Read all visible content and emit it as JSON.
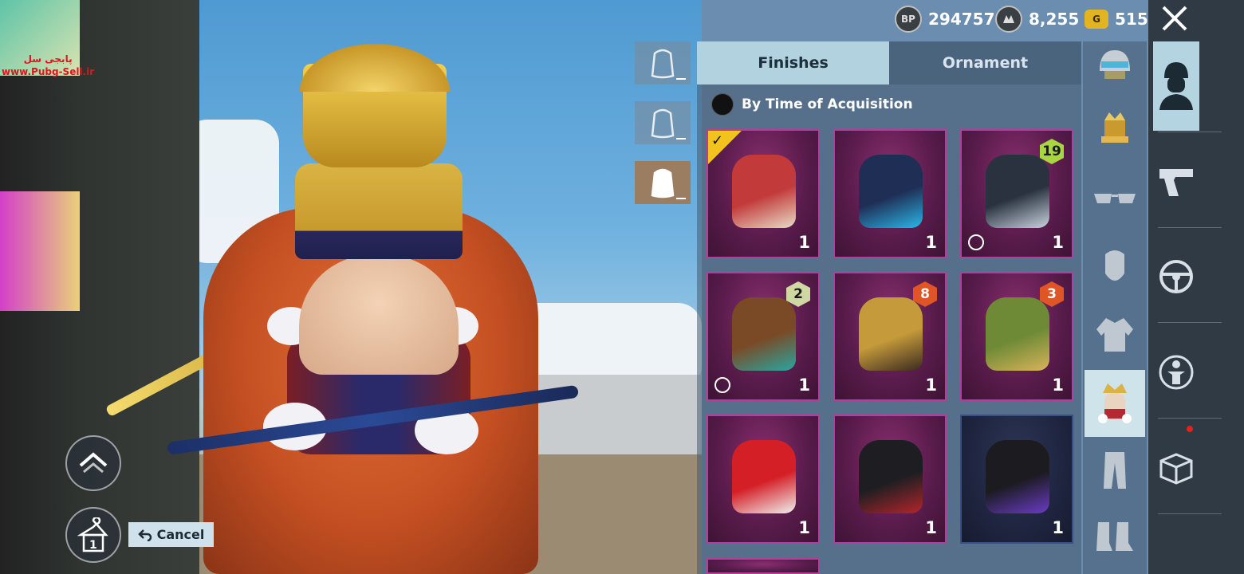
{
  "currency": {
    "bp": {
      "icon": "BP",
      "value": "294757"
    },
    "silver": {
      "icon": "silver-fragment-icon",
      "value": "8,255"
    },
    "uc": {
      "icon": "G",
      "value": "515"
    }
  },
  "watermark": {
    "line1": "پابجی سل",
    "line2": "www.Pubg-Sell.ir"
  },
  "tabs": {
    "finishes": "Finishes",
    "ornament": "Ornament"
  },
  "sort": {
    "label": "By Time of Acquisition"
  },
  "cancel": {
    "label": "Cancel"
  },
  "wardrobe_badge": "1",
  "items": [
    {
      "name": "nutcracker-backpack",
      "qty": "1",
      "equipped": true,
      "level": "",
      "cloud": false,
      "style": "purple",
      "colors": [
        "#c23a3a",
        "#e8dcc8"
      ]
    },
    {
      "name": "blue-tech-backpack",
      "qty": "1",
      "equipped": false,
      "level": "",
      "cloud": false,
      "style": "purple",
      "colors": [
        "#1f2e55",
        "#2bb7e8"
      ]
    },
    {
      "name": "dark-horned-backpack",
      "qty": "1",
      "equipped": false,
      "level": "19",
      "cloud": true,
      "style": "purple",
      "colors": [
        "#2a3240",
        "#c9d3df"
      ]
    },
    {
      "name": "aztec-backpack",
      "qty": "1",
      "equipped": false,
      "level": "2",
      "cloud": true,
      "style": "purple",
      "colors": [
        "#7a4a26",
        "#2aa6a0"
      ]
    },
    {
      "name": "golden-tribal-backpack",
      "qty": "1",
      "equipped": false,
      "level": "8",
      "cloud": false,
      "style": "purple",
      "colors": [
        "#c59a3a",
        "#3a2a20"
      ]
    },
    {
      "name": "jungle-backpack",
      "qty": "1",
      "equipped": false,
      "level": "3",
      "cloud": false,
      "style": "purple",
      "colors": [
        "#6f8a36",
        "#d8b45a"
      ]
    },
    {
      "name": "liverpool-backpack",
      "qty": "1",
      "equipped": false,
      "level": "",
      "cloud": false,
      "style": "purple",
      "colors": [
        "#d41f26",
        "#f0f0f0"
      ]
    },
    {
      "name": "dark-red-backpack",
      "qty": "1",
      "equipped": false,
      "level": "",
      "cloud": false,
      "style": "purple",
      "colors": [
        "#1e1e22",
        "#b3262c"
      ]
    },
    {
      "name": "black-purple-backpack",
      "qty": "1",
      "equipped": false,
      "level": "",
      "cloud": false,
      "style": "blue",
      "colors": [
        "#1b1b20",
        "#6b3cc6"
      ]
    }
  ],
  "level_colors": {
    "19": "#a7d640",
    "2": "#cfd7a3",
    "8": "#e05525",
    "3": "#e05525"
  }
}
